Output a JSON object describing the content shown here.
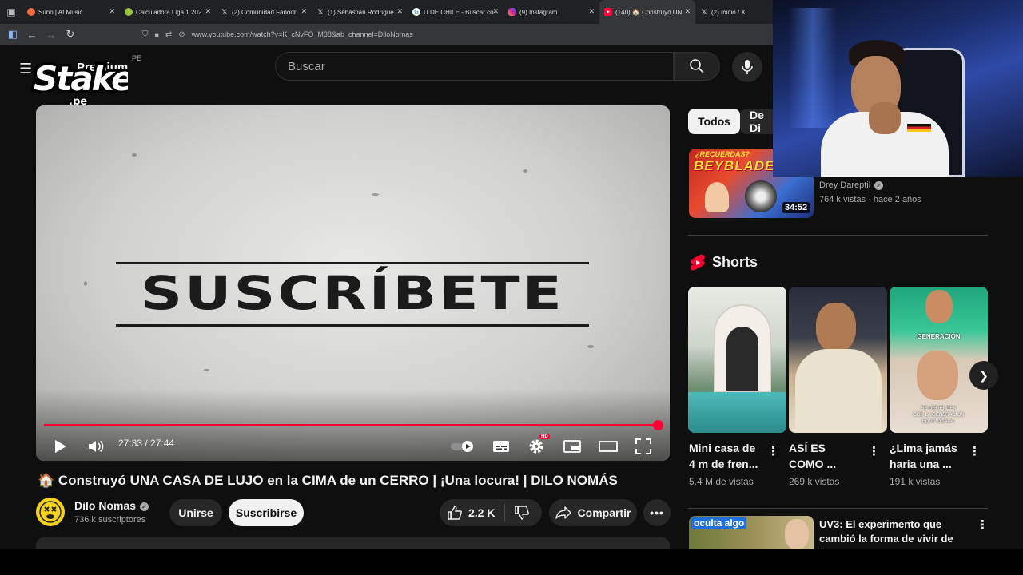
{
  "browser": {
    "tabs": [
      {
        "title": "Suno | AI Music",
        "icon": "suno-icon",
        "color": "#f26a3d",
        "active": false
      },
      {
        "title": "Calculadora Liga 1 202",
        "icon": "calc-icon",
        "color": "#9ac23c",
        "active": false
      },
      {
        "title": "(2) Comunidad Fanodr",
        "icon": "x-icon",
        "color": "#202124",
        "active": false
      },
      {
        "title": "(1) Sebastián Rodrígue",
        "icon": "x-icon",
        "color": "#202124",
        "active": false
      },
      {
        "title": "U DE CHILE - Buscar co",
        "icon": "google-icon",
        "color": "#4285f4",
        "active": false
      },
      {
        "title": "(9) Instagram",
        "icon": "instagram-icon",
        "color": "#d6249f",
        "active": false
      },
      {
        "title": "(140) 🏠 Construyó UN",
        "icon": "youtube-icon",
        "color": "#ff0033",
        "active": true
      },
      {
        "title": "(2) Inicio / X",
        "icon": "x-icon",
        "color": "#202124",
        "active": false
      }
    ],
    "url": "www.youtube.com/watch?v=K_cNvFO_M38&ab_channel=DiloNomas"
  },
  "youtube": {
    "premium_label": "Premium",
    "country": "PE",
    "search_placeholder": "Buscar",
    "stake_logo": "Stake",
    "stake_sub": ".pe"
  },
  "player": {
    "overlay_text": "SUSCRÍBETE",
    "time_current": "27:33",
    "time_sep": " / ",
    "time_total": "27:44",
    "progress": 0.993,
    "hd_badge": "HD"
  },
  "video": {
    "title": "🏠 Construyó UNA CASA DE LUJO en la CIMA de un CERRO | ¡Una locura! | DILO NOMÁS",
    "channel": "Dilo Nomas",
    "subscribers": "736 k suscriptores",
    "join_label": "Unirse",
    "subscribe_label": "Suscribirse",
    "likes": "2.2 K",
    "share_label": "Compartir"
  },
  "sidebar": {
    "chips": [
      "Todos",
      "De Di"
    ],
    "related": {
      "thumb_top": "¿RECUERDAS?",
      "thumb_text": "BEYBLADE",
      "duration": "34:52",
      "channel": "Drey Dareptil",
      "meta": "764 k vistas · hace 2 años"
    },
    "shorts_title": "Shorts",
    "shorts": [
      {
        "title_l1": "Mini casa de",
        "title_l2": "4 m de fren...",
        "views": "5.4 M de vistas"
      },
      {
        "title_l1": "ASÍ ES",
        "title_l2": "COMO ...",
        "views": "269 k vistas"
      },
      {
        "title_l1": "¿Lima jamás",
        "title_l2": "haria una ...",
        "views": "191 k vistas",
        "thumb_label": "GENERACIÓN",
        "thumb_caption_l1": "SE DEFIENDEN",
        "thumb_caption_l2": "CON LA GENERACIÓN",
        "thumb_caption_l3": "EQUIVOCADA."
      }
    ],
    "next_video": {
      "thumb_tag": "oculta algo",
      "title_l1": "UV3: El experimento que",
      "title_l2": "cambió la forma de vivir de los..."
    }
  }
}
